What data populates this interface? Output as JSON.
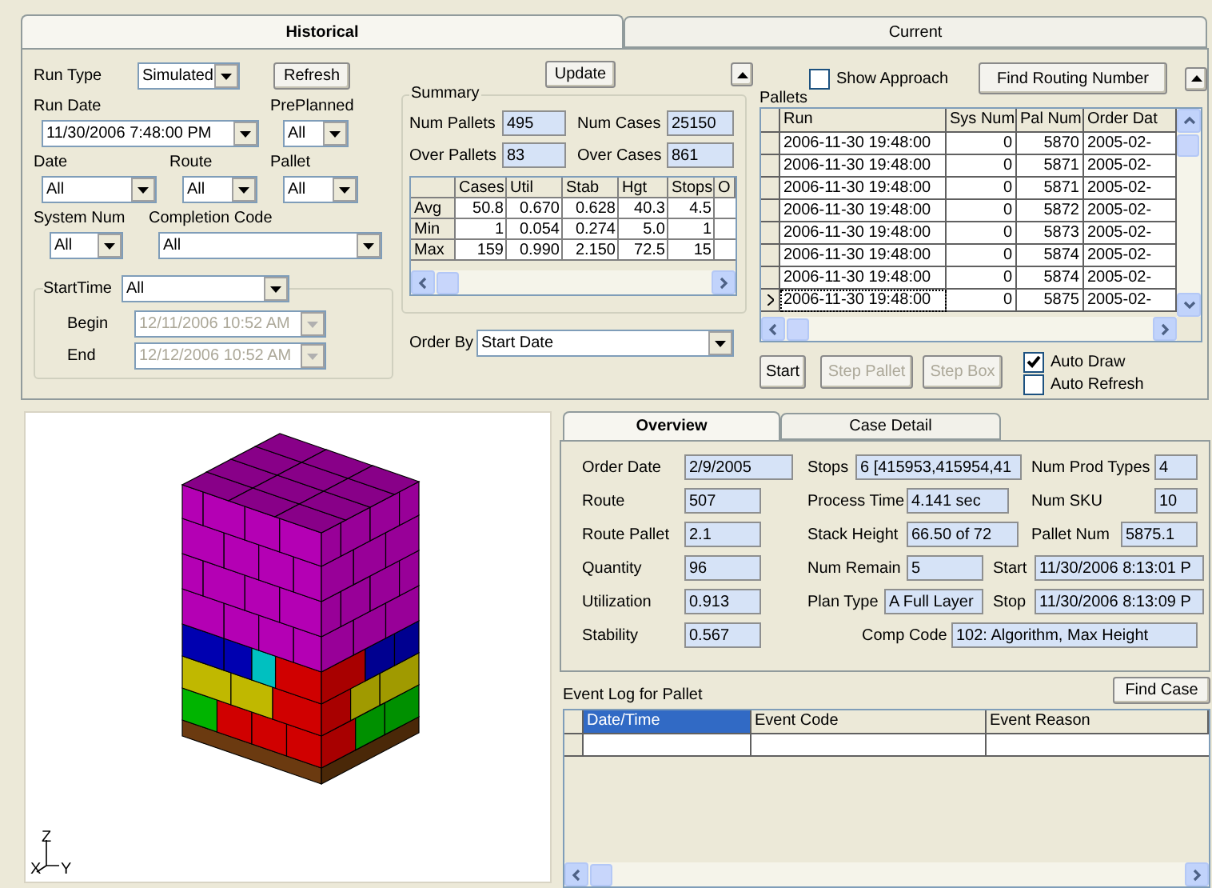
{
  "tabs": [
    {
      "label": "Historical",
      "selected": true
    },
    {
      "label": "Current",
      "selected": false
    }
  ],
  "filters": {
    "run_type": {
      "label": "Run Type",
      "value": "Simulated"
    },
    "refresh_button": "Refresh",
    "run_date": {
      "label": "Run Date",
      "value": "11/30/2006 7:48:00 PM"
    },
    "preplanned": {
      "label": "PrePlanned",
      "value": "All"
    },
    "date": {
      "label": "Date",
      "value": "All"
    },
    "route": {
      "label": "Route",
      "value": "All"
    },
    "pallet": {
      "label": "Pallet",
      "value": "All"
    },
    "system_num": {
      "label": "System Num",
      "value": "All"
    },
    "completion_code": {
      "label": "Completion Code",
      "value": "All"
    },
    "start_time": {
      "label": "StartTime",
      "value": "All",
      "begin": {
        "label": "Begin",
        "value": "12/11/2006  10:52 AM",
        "disabled": true
      },
      "end": {
        "label": "End",
        "value": "12/12/2006  10:52 AM",
        "disabled": true
      }
    }
  },
  "update_button": "Update",
  "summary": {
    "title": "Summary",
    "fields": [
      {
        "label": "Num Pallets",
        "value": "495"
      },
      {
        "label": "Num Cases",
        "value": "25150"
      },
      {
        "label": "Over Pallets",
        "value": "83"
      },
      {
        "label": "Over Cases",
        "value": "861"
      }
    ],
    "table": {
      "columns": [
        "Cases",
        "Util",
        "Stab",
        "Hgt",
        "Stops",
        "O"
      ],
      "rows": [
        {
          "label": "Avg",
          "cells": [
            "50.8",
            "0.670",
            "0.628",
            "40.3",
            "4.5"
          ]
        },
        {
          "label": "Min",
          "cells": [
            "1",
            "0.054",
            "0.274",
            "5.0",
            "1"
          ]
        },
        {
          "label": "Max",
          "cells": [
            "159",
            "0.990",
            "2.150",
            "72.5",
            "15"
          ]
        }
      ]
    }
  },
  "order_by": {
    "label": "Order By",
    "value": "Start Date"
  },
  "show_approach": {
    "label": "Show Approach",
    "checked": false
  },
  "find_routing_button": "Find Routing Number",
  "pallets": {
    "title": "Pallets",
    "columns": [
      "Run",
      "Sys Num",
      "Pal Num",
      "Order Dat"
    ],
    "rows": [
      {
        "cells": [
          "2006-11-30 19:48:00",
          "0",
          "5870",
          "2005-02-"
        ],
        "selected": false
      },
      {
        "cells": [
          "2006-11-30 19:48:00",
          "0",
          "5871",
          "2005-02-"
        ],
        "selected": false
      },
      {
        "cells": [
          "2006-11-30 19:48:00",
          "0",
          "5871",
          "2005-02-"
        ],
        "selected": false
      },
      {
        "cells": [
          "2006-11-30 19:48:00",
          "0",
          "5872",
          "2005-02-"
        ],
        "selected": false
      },
      {
        "cells": [
          "2006-11-30 19:48:00",
          "0",
          "5873",
          "2005-02-"
        ],
        "selected": false
      },
      {
        "cells": [
          "2006-11-30 19:48:00",
          "0",
          "5874",
          "2005-02-"
        ],
        "selected": false
      },
      {
        "cells": [
          "2006-11-30 19:48:00",
          "0",
          "5874",
          "2005-02-"
        ],
        "selected": false
      },
      {
        "cells": [
          "2006-11-30 19:48:00",
          "0",
          "5875",
          "2005-02-"
        ],
        "selected": true
      }
    ]
  },
  "pallet_buttons": [
    {
      "label": "Start",
      "disabled": false
    },
    {
      "label": "Step Pallet",
      "disabled": true
    },
    {
      "label": "Step Box",
      "disabled": true
    }
  ],
  "options": [
    {
      "label": "Auto Draw",
      "checked": true
    },
    {
      "label": "Auto Refresh",
      "checked": false
    }
  ],
  "view_axes": {
    "z": "Z",
    "x": "X",
    "y": "Y"
  },
  "detail_tabs": [
    {
      "label": "Overview",
      "selected": true
    },
    {
      "label": "Case Detail",
      "selected": false
    }
  ],
  "overview": {
    "rows": [
      [
        {
          "label": "Order Date",
          "value": "2/9/2005"
        },
        {
          "label": "Stops",
          "value": "6 [415953,415954,41"
        },
        {
          "label": "Num Prod Types",
          "value": "4"
        }
      ],
      [
        {
          "label": "Route",
          "value": "507"
        },
        {
          "label": "Process Time",
          "value": "4.141 sec"
        },
        {
          "label": "Num SKU",
          "value": "10"
        }
      ],
      [
        {
          "label": "Route Pallet",
          "value": "2.1"
        },
        {
          "label": "Stack Height",
          "value": "66.50 of 72"
        },
        {
          "label": "Pallet Num",
          "value": "5875.1"
        }
      ],
      [
        {
          "label": "Quantity",
          "value": "96"
        },
        {
          "label": "Num Remain",
          "value": "5"
        },
        {
          "label": "Start",
          "value": "11/30/2006 8:13:01 P"
        }
      ],
      [
        {
          "label": "Utilization",
          "value": "0.913"
        },
        {
          "label": "Plan Type",
          "value": "A Full Layer"
        },
        {
          "label": "Stop",
          "value": "11/30/2006 8:13:09 P"
        }
      ],
      [
        {
          "label": "Stability",
          "value": "0.567"
        },
        {
          "label": "Comp Code",
          "value": "102: Algorithm, Max Height"
        }
      ]
    ]
  },
  "event_log": {
    "title": "Event Log for Pallet",
    "find_button": "Find Case",
    "columns": [
      {
        "label": "Date/Time",
        "selected": true
      },
      {
        "label": "Event Code",
        "selected": false
      },
      {
        "label": "Event Reason",
        "selected": false
      }
    ]
  }
}
